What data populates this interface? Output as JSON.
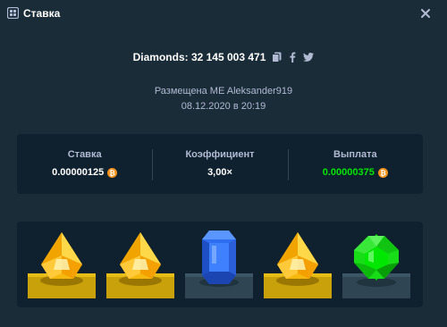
{
  "header": {
    "title": "Ставка",
    "title_icon": "bet-slip-icon",
    "close_icon": "close-icon"
  },
  "bet": {
    "diamonds_label": "Diamonds: 32 145 003 471",
    "share_icons": [
      "copy-icon",
      "facebook-icon",
      "twitter-icon"
    ],
    "placed_by": "Размещена ME Aleksander919",
    "date": "08.12.2020 в 20:19"
  },
  "stats": {
    "stake_label": "Ставка",
    "stake_value": "0.00000125",
    "multiplier_label": "Коэффициент",
    "multiplier_value": "3,00×",
    "payout_label": "Выплата",
    "payout_value": "0.00000375",
    "currency_icon": "bitcoin-icon"
  },
  "gems": [
    "yellow",
    "yellow",
    "blue",
    "yellow",
    "green"
  ],
  "colors": {
    "background": "#1a2c38",
    "panel": "#0f212e",
    "payout_green": "#00e701",
    "muted_text": "#b1bad3",
    "coin_orange": "#f7931a",
    "active_base": "#c9a10a",
    "inactive_base": "#2f4553"
  }
}
